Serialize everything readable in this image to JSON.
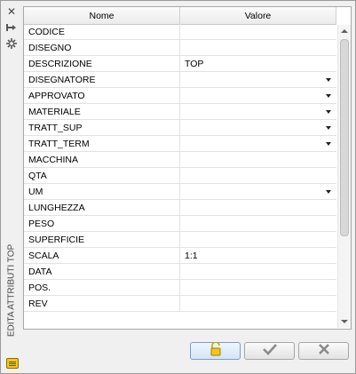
{
  "panel": {
    "title": "EDITA ATTRIBUTI TOP",
    "icons": [
      "close-icon",
      "pin-icon",
      "settings-icon",
      "list-icon"
    ]
  },
  "grid": {
    "columns": {
      "name": "Nome",
      "value": "Valore"
    },
    "rows": [
      {
        "name": "CODICE",
        "value": "",
        "dropdown": false
      },
      {
        "name": "DISEGNO",
        "value": "",
        "dropdown": false
      },
      {
        "name": "DESCRIZIONE",
        "value": "TOP",
        "dropdown": false
      },
      {
        "name": "DISEGNATORE",
        "value": "",
        "dropdown": true
      },
      {
        "name": "APPROVATO",
        "value": "",
        "dropdown": true
      },
      {
        "name": "MATERIALE",
        "value": "",
        "dropdown": true
      },
      {
        "name": "TRATT_SUP",
        "value": "",
        "dropdown": true
      },
      {
        "name": "TRATT_TERM",
        "value": "",
        "dropdown": true
      },
      {
        "name": "MACCHINA",
        "value": "",
        "dropdown": false
      },
      {
        "name": "QTA",
        "value": "",
        "dropdown": false
      },
      {
        "name": "UM",
        "value": "",
        "dropdown": true
      },
      {
        "name": "LUNGHEZZA",
        "value": "",
        "dropdown": false
      },
      {
        "name": "PESO",
        "value": "",
        "dropdown": false
      },
      {
        "name": "SUPERFICIE",
        "value": "",
        "dropdown": false
      },
      {
        "name": "SCALA",
        "value": "1:1",
        "dropdown": false
      },
      {
        "name": "DATA",
        "value": "",
        "dropdown": false
      },
      {
        "name": "POS.",
        "value": "",
        "dropdown": false
      },
      {
        "name": "REV",
        "value": "",
        "dropdown": false
      }
    ]
  },
  "buttons": {
    "lock": "lock-icon",
    "ok": "checkmark-icon",
    "cancel": "x-icon"
  }
}
